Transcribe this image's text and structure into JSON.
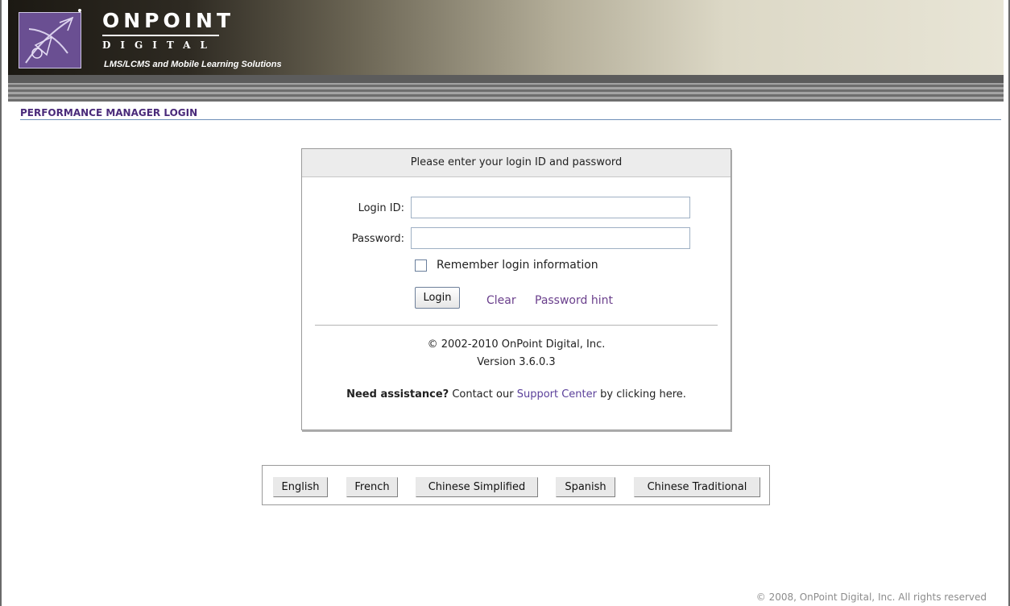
{
  "header": {
    "brand_title": "ONPOINT",
    "brand_sub": "DIGITAL",
    "tagline": "LMS/LCMS and Mobile Learning Solutions"
  },
  "page": {
    "title": "PERFORMANCE MANAGER LOGIN"
  },
  "login": {
    "heading": "Please enter your login ID and password",
    "login_id_label": "Login ID:",
    "login_id_value": "",
    "password_label": "Password:",
    "password_value": "",
    "remember_label": "Remember login information",
    "remember_checked": false,
    "login_button": "Login",
    "clear_link": "Clear",
    "hint_link": "Password hint",
    "copyright_line1": "© 2002-2010 OnPoint Digital, Inc.",
    "copyright_line2": "Version 3.6.0.3",
    "assist_bold": "Need assistance?",
    "assist_text1": " Contact our ",
    "assist_link": "Support Center",
    "assist_text2": " by clicking here."
  },
  "languages": [
    "English",
    "French",
    "Chinese Simplified",
    "Spanish",
    "Chinese Traditional"
  ],
  "footer": {
    "text": "© 2008, OnPoint Digital, Inc. All rights reserved"
  },
  "colors": {
    "title_purple": "#4a2a7a",
    "link_purple": "#6a3f8c",
    "logo_bg": "#6a4f92"
  }
}
